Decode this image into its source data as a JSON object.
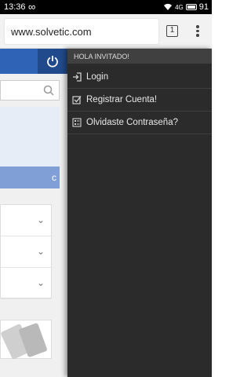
{
  "status_bar": {
    "time": "13:36",
    "infinity": "∞",
    "network": "4G",
    "battery": "91"
  },
  "browser": {
    "url": "www.solvetic.com",
    "tab_count": "1"
  },
  "page": {
    "bar_text": "c"
  },
  "drawer": {
    "header": "HOLA INVITADO!",
    "items": [
      {
        "label": "Login",
        "icon": "login-icon"
      },
      {
        "label": "Registrar Cuenta!",
        "icon": "checkbox-icon"
      },
      {
        "label": "Olvidaste Contraseña?",
        "icon": "form-icon"
      }
    ]
  }
}
